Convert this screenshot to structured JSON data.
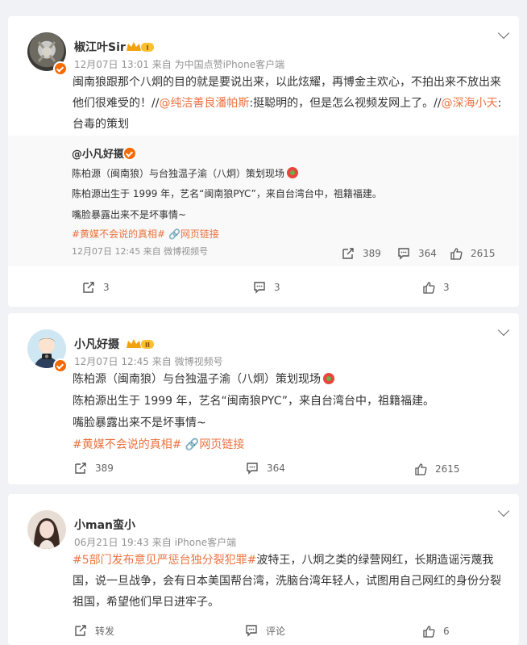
{
  "colors": {
    "accent": "#eb7340",
    "meta": "#939393",
    "verified": "#f46a00"
  },
  "posts": [
    {
      "author": "椒江叶Sir",
      "level": "I",
      "meta": "12月07日 13:01  来自 为中国点赞iPhone客户端",
      "text_a": "闽南狼跟那个八炯的目的就是要说出来，以此炫耀，再博金主欢心，不拍出来不放出来",
      "text_b": "他们很难受的！//",
      "mention1": "@纯洁善良潘帕斯",
      "text_c": ":挺聪明的，但是怎么视频发网上了。//",
      "mention2": "@深海小天",
      "text_d": ":",
      "text_e": "台毒的策划",
      "repost": {
        "author": "@小凡好摄",
        "line1": "陈柏源（闽南狼）与台独温子渝（八炯）策划现场",
        "line2": "陈柏源出生于 1999 年，艺名“闽南狼PYC”，来自台湾台中，祖籍福建。",
        "line3": "嘴脸暴露出来不是坏事情~",
        "tag": "#黄媒不会说的真相#",
        "link": "网页链接",
        "meta": "12月07日 12:45  来自 微博视频号",
        "reposts": "389",
        "comments": "364",
        "likes": "2615"
      },
      "reposts": "3",
      "comments": "3",
      "likes": "3"
    },
    {
      "author": "小凡好摄",
      "level": "II",
      "meta": "12月07日 12:45  来自 微博视频号",
      "line1": "陈柏源（闽南狼）与台独温子渝（八炯）策划现场",
      "line2": "陈柏源出生于 1999 年，艺名“闽南狼PYC”，来自台湾台中，祖籍福建。",
      "line3": "嘴脸暴露出来不是坏事情~",
      "tag": "#黄媒不会说的真相#",
      "link": "网页链接",
      "reposts": "389",
      "comments": "364",
      "likes": "2615"
    },
    {
      "author": "小man蛮小",
      "meta": "06月21日 19:43  来自 iPhone客户端",
      "tag": "#5部门发布意见严惩台独分裂犯罪#",
      "text_a": "波特王，八炯之类的绿营网红，长期造谣污蔑我",
      "text_b": "国，说一旦战争，会有日本美国帮台湾，洗脑台湾年轻人，试图用自己网红的身份分裂",
      "text_c": "祖国，希望他们早日进牢子。",
      "repost_label": "转发",
      "comment_label": "评论",
      "likes": "6"
    }
  ],
  "icons": [
    "repost-icon",
    "comment-icon",
    "like-icon",
    "chevron-down-icon",
    "link-icon",
    "verified-icon",
    "fire-icon"
  ]
}
